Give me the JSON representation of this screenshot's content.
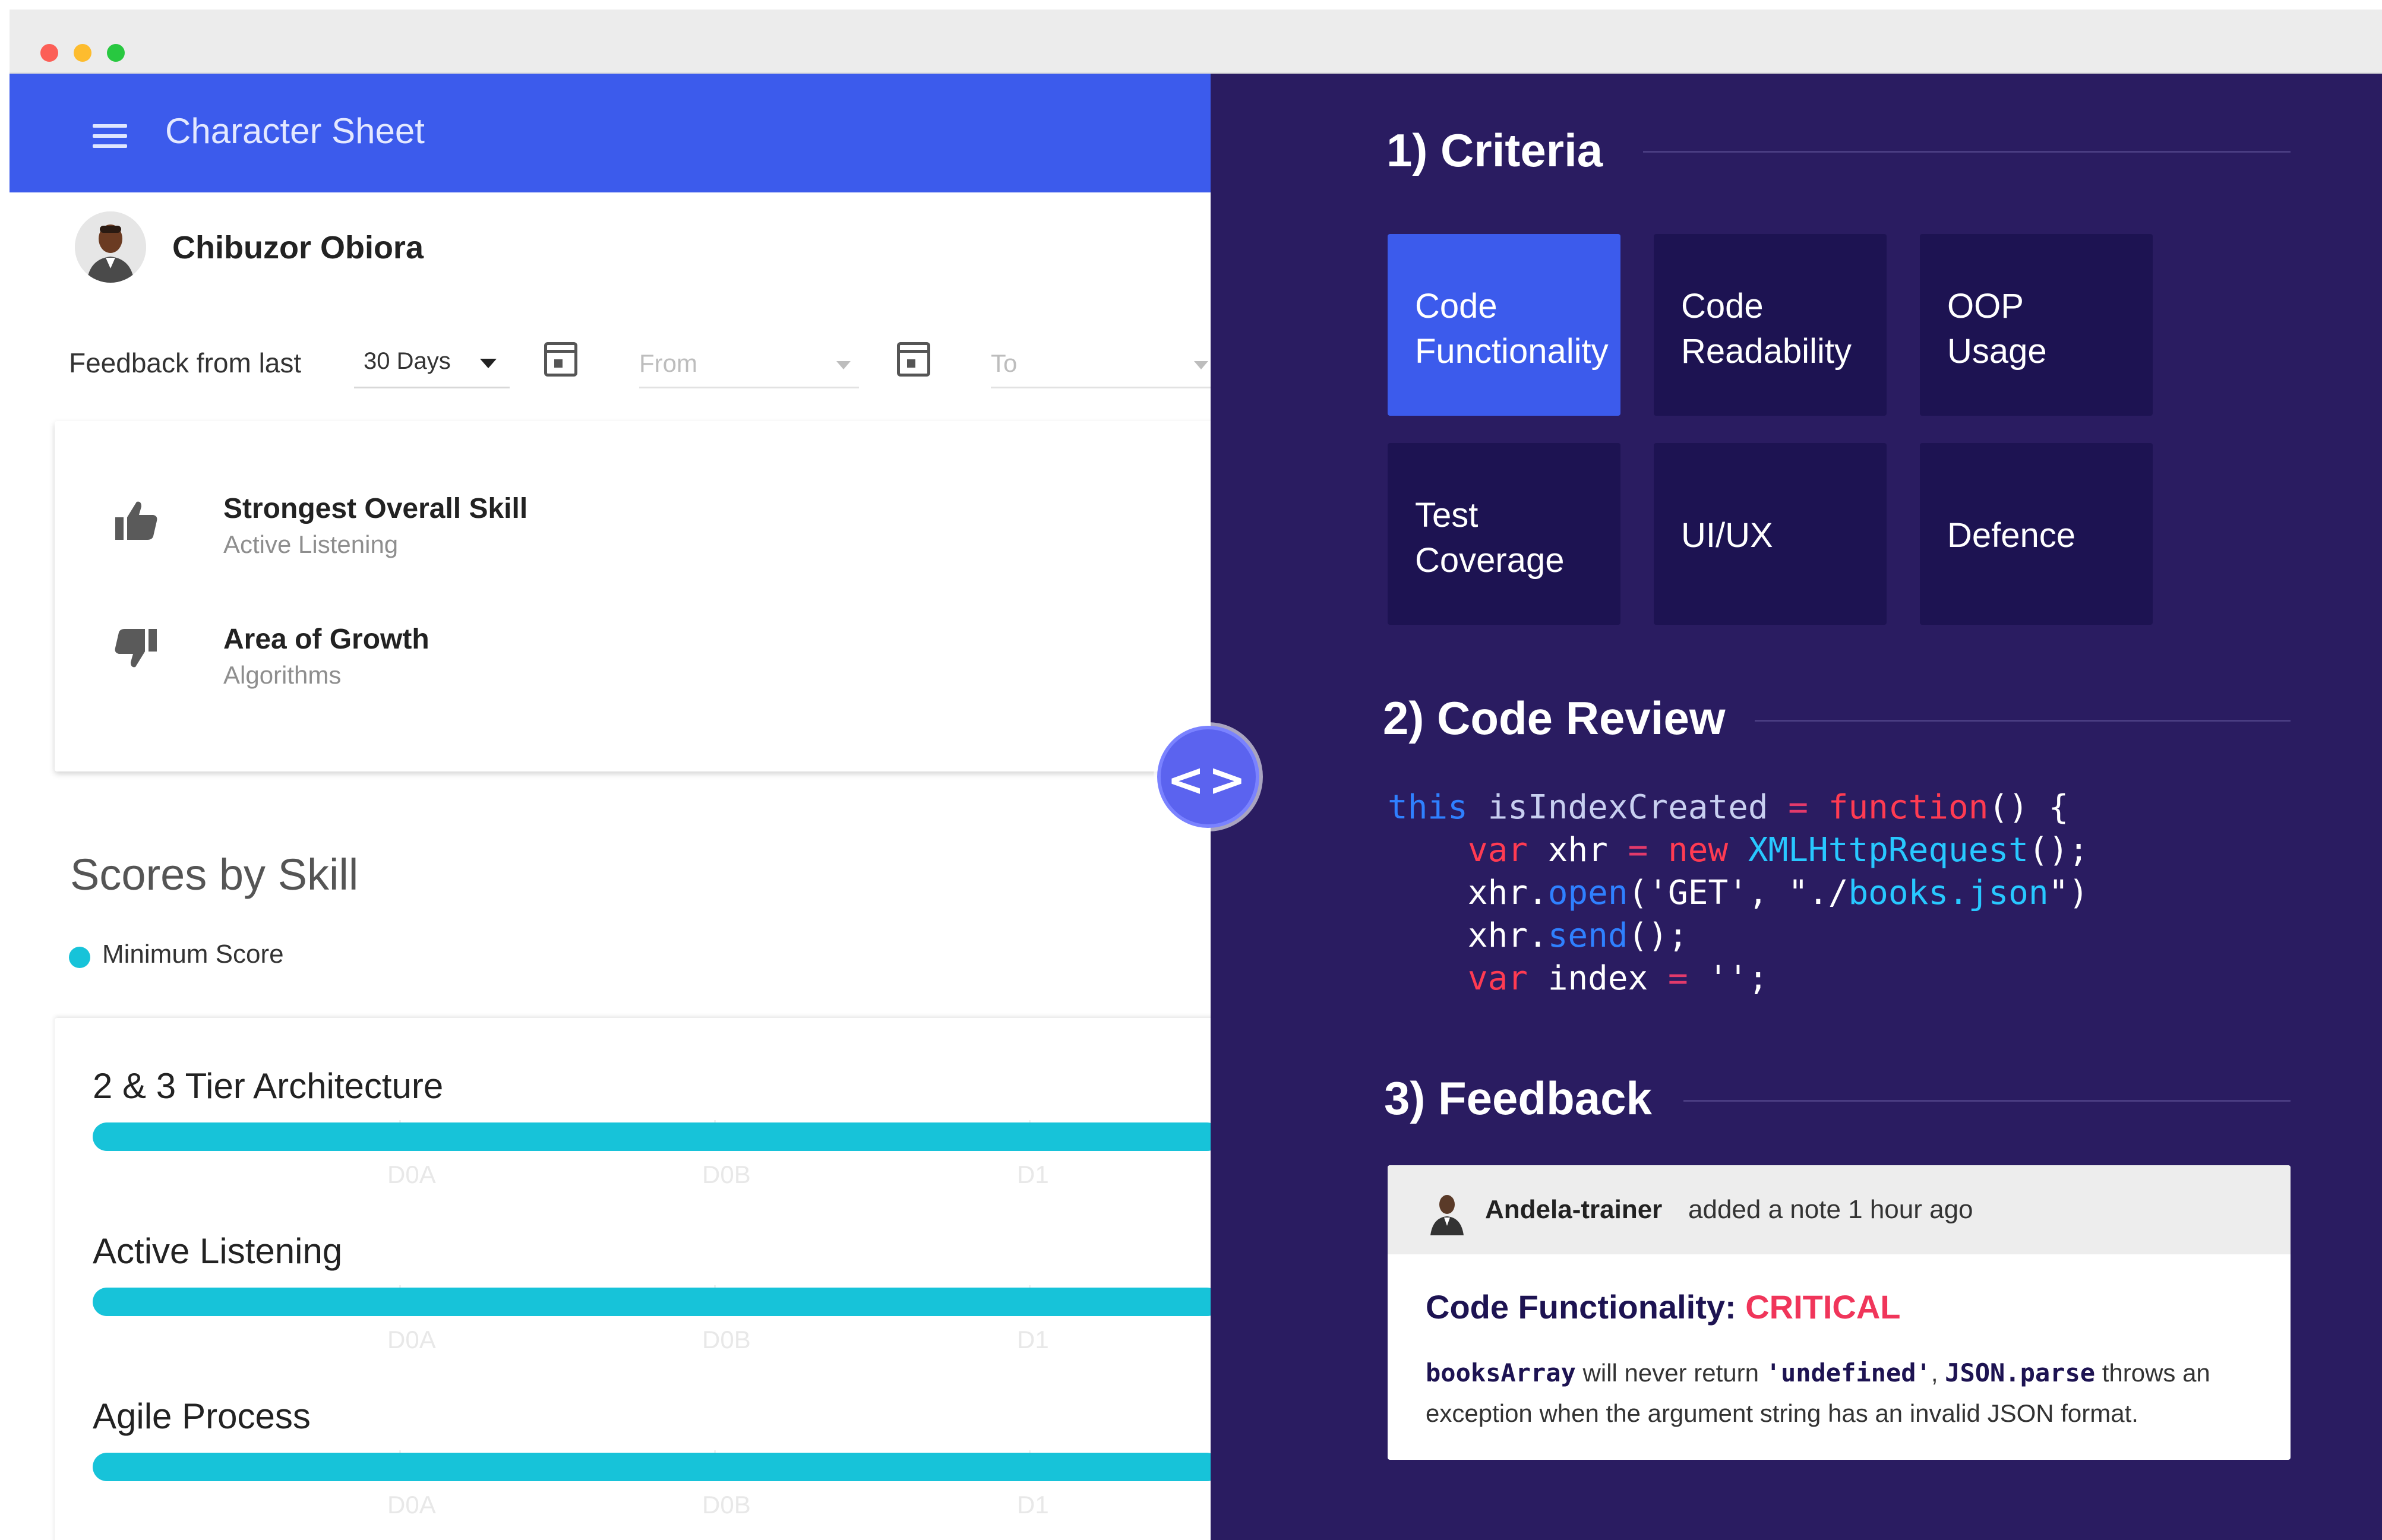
{
  "window": {
    "controls": [
      "close",
      "minimize",
      "maximize"
    ]
  },
  "left": {
    "app_title": "Character Sheet",
    "user_name": "Chibuzor Obiora",
    "filter": {
      "label": "Feedback from last",
      "period_value": "30 Days",
      "from_placeholder": "From",
      "to_placeholder": "To"
    },
    "skills": {
      "strongest_title": "Strongest Overall Skill",
      "strongest_value": "Active Listening",
      "growth_title": "Area of Growth",
      "growth_value": "Algorithms"
    },
    "scores": {
      "title": "Scores by Skill",
      "legend": "Minimum Score",
      "ticks": [
        "D0A",
        "D0B",
        "D1"
      ],
      "bars": [
        {
          "label": "2 & 3 Tier Architecture"
        },
        {
          "label": "Active Listening"
        },
        {
          "label": "Agile Process"
        }
      ]
    }
  },
  "toggle": {
    "glyph": "<>"
  },
  "right": {
    "criteria": {
      "title": "1) Criteria",
      "tiles": [
        {
          "label": "Code\nFunctionality",
          "active": true
        },
        {
          "label": "Code\nReadability",
          "active": false
        },
        {
          "label": "OOP\nUsage",
          "active": false
        },
        {
          "label": "Test\nCoverage",
          "active": false
        },
        {
          "label": "UI/UX",
          "active": false
        },
        {
          "label": "Defence",
          "active": false
        }
      ]
    },
    "code_review": {
      "title": "2) Code Review",
      "lines": [
        [
          [
            "this",
            "kw-this"
          ],
          [
            " isIndexCreated ",
            "var-id"
          ],
          [
            "=",
            "op"
          ],
          [
            " ",
            "plain"
          ],
          [
            "function",
            "kw"
          ],
          [
            "() {",
            "plain"
          ]
        ],
        [
          [
            "    ",
            "plain"
          ],
          [
            "var",
            "kw"
          ],
          [
            " xhr ",
            "plain"
          ],
          [
            "=",
            "op"
          ],
          [
            " ",
            "plain"
          ],
          [
            "new",
            "kw"
          ],
          [
            " ",
            "plain"
          ],
          [
            "XMLHttpRequest",
            "cls"
          ],
          [
            "();",
            "plain"
          ]
        ],
        [
          [
            "    xhr.",
            "plain"
          ],
          [
            "open",
            "meth"
          ],
          [
            "('GET', \"./",
            "str"
          ],
          [
            "books.json",
            "path"
          ],
          [
            "\")",
            "plain"
          ]
        ],
        [
          [
            "    xhr.",
            "plain"
          ],
          [
            "send",
            "meth"
          ],
          [
            "();",
            "plain"
          ]
        ],
        [
          [
            "    ",
            "plain"
          ],
          [
            "var",
            "kw"
          ],
          [
            " index ",
            "plain"
          ],
          [
            "=",
            "op"
          ],
          [
            " '';",
            "plain"
          ]
        ]
      ]
    },
    "feedback": {
      "title": "3) Feedback",
      "author": "Andela-trainer",
      "note": "added a note 1 hour ago",
      "heading_label": "Code Functionality: ",
      "heading_status": "CRITICAL",
      "body_code1": "booksArray",
      "body_text1": " will never return ",
      "body_code2": "'undefined'",
      "body_text2": ", ",
      "body_code3": "JSON.parse",
      "body_text3": " throws an exception when the argument string has an invalid JSON format."
    }
  },
  "colors": {
    "app_bar": "#3c5bec",
    "right_bg": "#2a1c61",
    "tile_bg": "#1d1352",
    "bar": "#17c3d9",
    "critical": "#f0355a"
  }
}
